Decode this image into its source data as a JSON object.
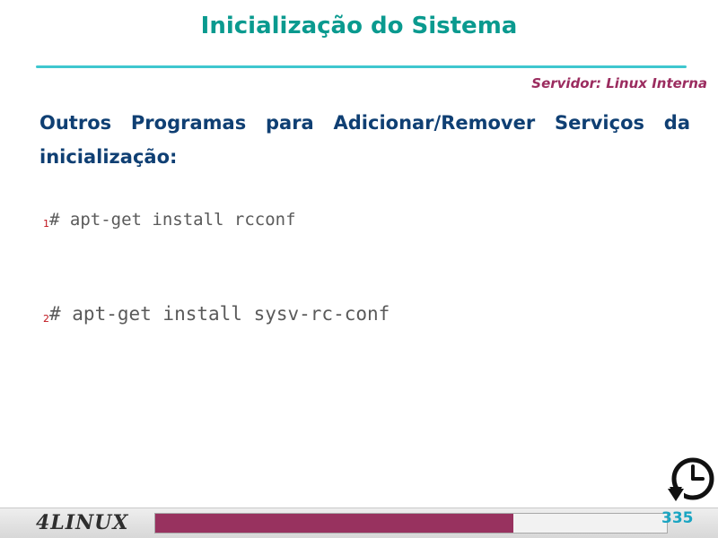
{
  "slide": {
    "title": "Inicialização do Sistema",
    "subtitle": "Servidor: Linux Interna",
    "heading": "Outros Programas para Adicionar/Remover Serviços da inicialização:"
  },
  "commands": [
    {
      "number": "1",
      "text": "# apt-get install rcconf"
    },
    {
      "number": "2",
      "text": "# apt-get install sysv-rc-conf"
    }
  ],
  "footer": {
    "brand": "4LINUX",
    "page_number": "335",
    "progress_fraction": 0.7,
    "progress_color": "#98325f"
  },
  "colors": {
    "title": "#0a9a8f",
    "subtitle": "#9b2c5f",
    "heading": "#0f3f73",
    "accent_rule": "#3fc7cf",
    "page_number": "#1aa5c2"
  },
  "icons": {
    "timer": "timer-icon"
  }
}
